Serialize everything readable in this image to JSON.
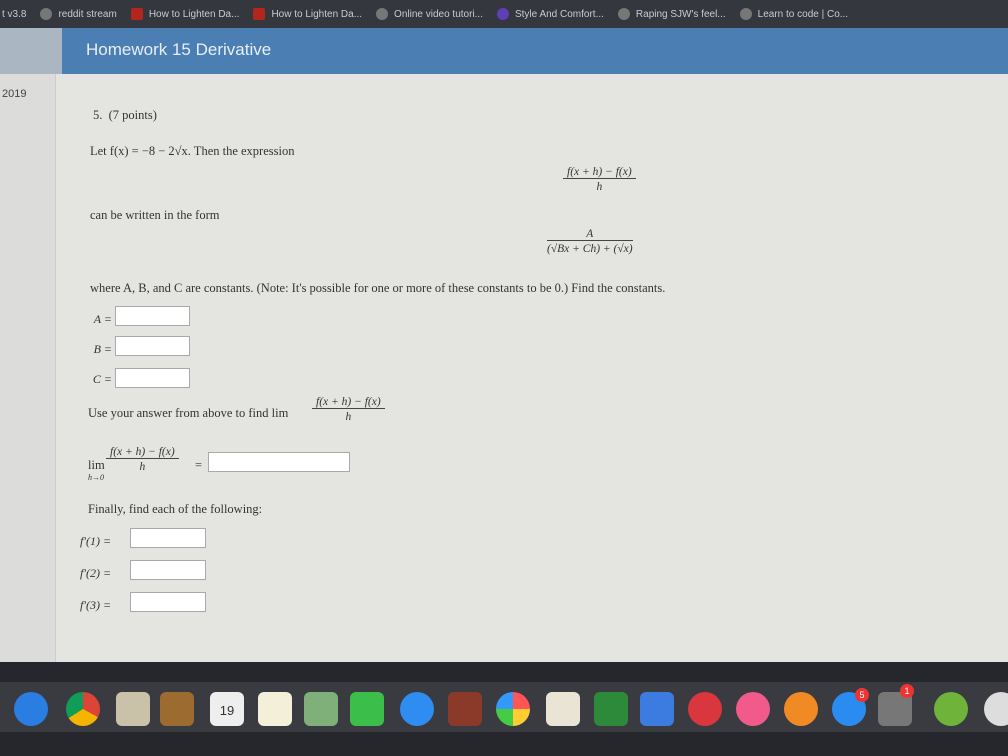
{
  "browser": {
    "tabs": [
      {
        "label": "t v3.8",
        "icon": "none"
      },
      {
        "label": "reddit stream",
        "icon": "globe-icon"
      },
      {
        "label": "How to Lighten Da...",
        "icon": "youtube-icon"
      },
      {
        "label": "How to Lighten Da...",
        "icon": "youtube-icon"
      },
      {
        "label": "Online video tutori...",
        "icon": "site-icon"
      },
      {
        "label": "Style And Comfort...",
        "icon": "peace-icon"
      },
      {
        "label": "Raping SJW's feel...",
        "icon": "site-icon"
      },
      {
        "label": "Learn to code | Co...",
        "icon": "site-icon"
      }
    ]
  },
  "header": {
    "title": "Homework 15 Derivative"
  },
  "sidebar": {
    "year": "2019"
  },
  "problem": {
    "number": "5.",
    "points": "(7 points)",
    "intro": "Let f(x) = −8 − 2√x. Then the expression",
    "expr_num": "f(x + h) − f(x)",
    "expr_den": "h",
    "form_text": "can be written in the form",
    "form_num": "A",
    "form_den": "(√Bx + Ch) + (√x)",
    "where_text": "where A, B, and C are constants. (Note: It's possible for one or more of these constants to be 0.) Find the constants.",
    "labels": {
      "a": "A =",
      "b": "B =",
      "c": "C ="
    },
    "limit_text": "Use your answer from above to find lim",
    "lim": "lim",
    "lim_sub": "h→0",
    "eq": "=",
    "finally_text": "Finally, find each of the following:",
    "derivs": [
      "f′(1) =",
      "f′(2) =",
      "f′(3) ="
    ]
  },
  "dock": {
    "calendar_day": "19",
    "badges": {
      "app_store": "5",
      "settings": "1"
    }
  }
}
